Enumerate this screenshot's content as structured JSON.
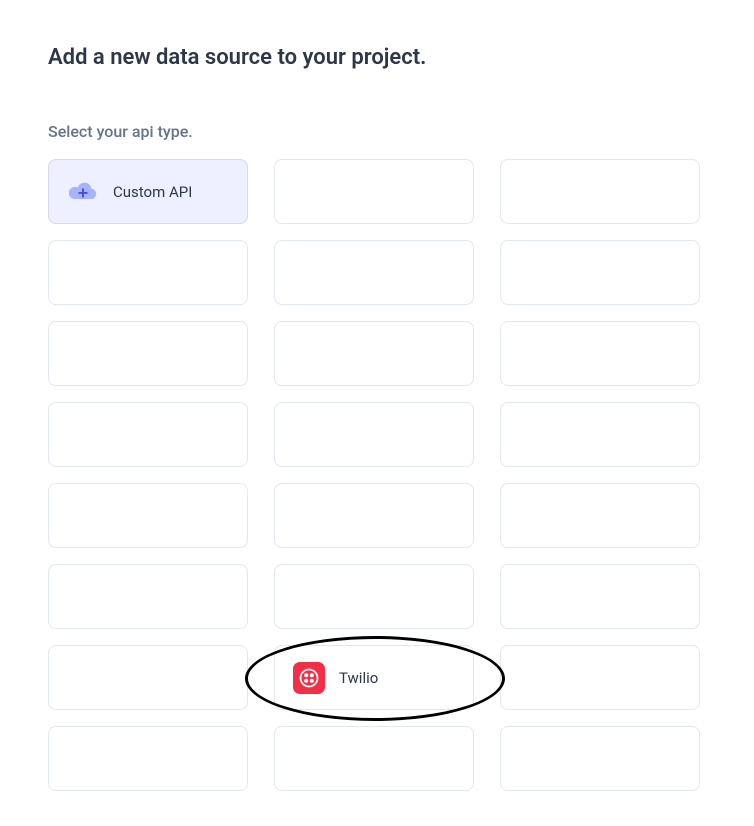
{
  "header": {
    "title": "Add a new data source to your project."
  },
  "subtitle": "Select your api type.",
  "api_options": [
    {
      "label": "Custom API",
      "icon": "cloud-plus",
      "selected": true
    },
    {
      "label": "",
      "icon": "",
      "selected": false
    },
    {
      "label": "",
      "icon": "",
      "selected": false
    },
    {
      "label": "",
      "icon": "",
      "selected": false
    },
    {
      "label": "",
      "icon": "",
      "selected": false
    },
    {
      "label": "",
      "icon": "",
      "selected": false
    },
    {
      "label": "",
      "icon": "",
      "selected": false
    },
    {
      "label": "",
      "icon": "",
      "selected": false
    },
    {
      "label": "",
      "icon": "",
      "selected": false
    },
    {
      "label": "",
      "icon": "",
      "selected": false
    },
    {
      "label": "",
      "icon": "",
      "selected": false
    },
    {
      "label": "",
      "icon": "",
      "selected": false
    },
    {
      "label": "",
      "icon": "",
      "selected": false
    },
    {
      "label": "",
      "icon": "",
      "selected": false
    },
    {
      "label": "",
      "icon": "",
      "selected": false
    },
    {
      "label": "",
      "icon": "",
      "selected": false
    },
    {
      "label": "",
      "icon": "",
      "selected": false
    },
    {
      "label": "",
      "icon": "",
      "selected": false
    },
    {
      "label": "",
      "icon": "",
      "selected": false
    },
    {
      "label": "Twilio",
      "icon": "twilio",
      "selected": false,
      "highlighted": true
    },
    {
      "label": "",
      "icon": "",
      "selected": false
    },
    {
      "label": "",
      "icon": "",
      "selected": false
    },
    {
      "label": "",
      "icon": "",
      "selected": false
    },
    {
      "label": "",
      "icon": "",
      "selected": false
    }
  ]
}
